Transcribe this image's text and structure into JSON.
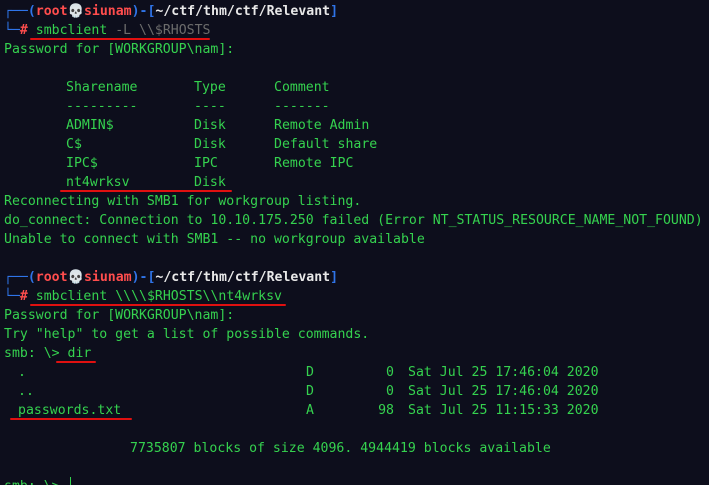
{
  "prompt": {
    "user": "root",
    "skull": "💀",
    "host": "siunam",
    "path": "~/ctf/thm/ctf/Relevant",
    "hash": "#"
  },
  "commands": {
    "first": {
      "bin": "smbclient",
      "args": "-L \\\\$RHOSTS"
    },
    "second": {
      "bin": "smbclient",
      "args": "\\\\\\\\$RHOSTS\\\\nt4wrksv"
    }
  },
  "password_prompt": "Password for [WORKGROUP\\nam]:",
  "share_table": {
    "headers": [
      "Sharename",
      "Type",
      "Comment"
    ],
    "dashes": [
      "---------",
      "----",
      "-------"
    ],
    "rows": [
      [
        "ADMIN$",
        "Disk",
        "Remote Admin"
      ],
      [
        "C$",
        "Disk",
        "Default share"
      ],
      [
        "IPC$",
        "IPC",
        "Remote IPC"
      ],
      [
        "nt4wrksv",
        "Disk",
        ""
      ]
    ]
  },
  "smb1_messages": [
    "Reconnecting with SMB1 for workgroup listing.",
    "do_connect: Connection to 10.10.175.250 failed (Error NT_STATUS_RESOURCE_NAME_NOT_FOUND)",
    "Unable to connect with SMB1 -- no workgroup available"
  ],
  "help_hint": "Try \"help\" to get a list of possible commands.",
  "smb_prompt": "smb: \\>",
  "smb_command": "dir",
  "dir_listing": [
    {
      "name": ".",
      "attr": "D",
      "size": "0",
      "date": "Sat Jul 25 17:46:04 2020"
    },
    {
      "name": "..",
      "attr": "D",
      "size": "0",
      "date": "Sat Jul 25 17:46:04 2020"
    },
    {
      "name": "passwords.txt",
      "attr": "A",
      "size": "98",
      "date": "Sat Jul 25 11:15:33 2020"
    }
  ],
  "blocks_info": "7735807 blocks of size 4096. 4944419 blocks available",
  "colors": {
    "background": "#0d0e1c",
    "output_green": "#35d24f",
    "prompt_blue": "#2f74e8",
    "prompt_red": "#ff4d4d",
    "underline_red": "#e01010"
  }
}
